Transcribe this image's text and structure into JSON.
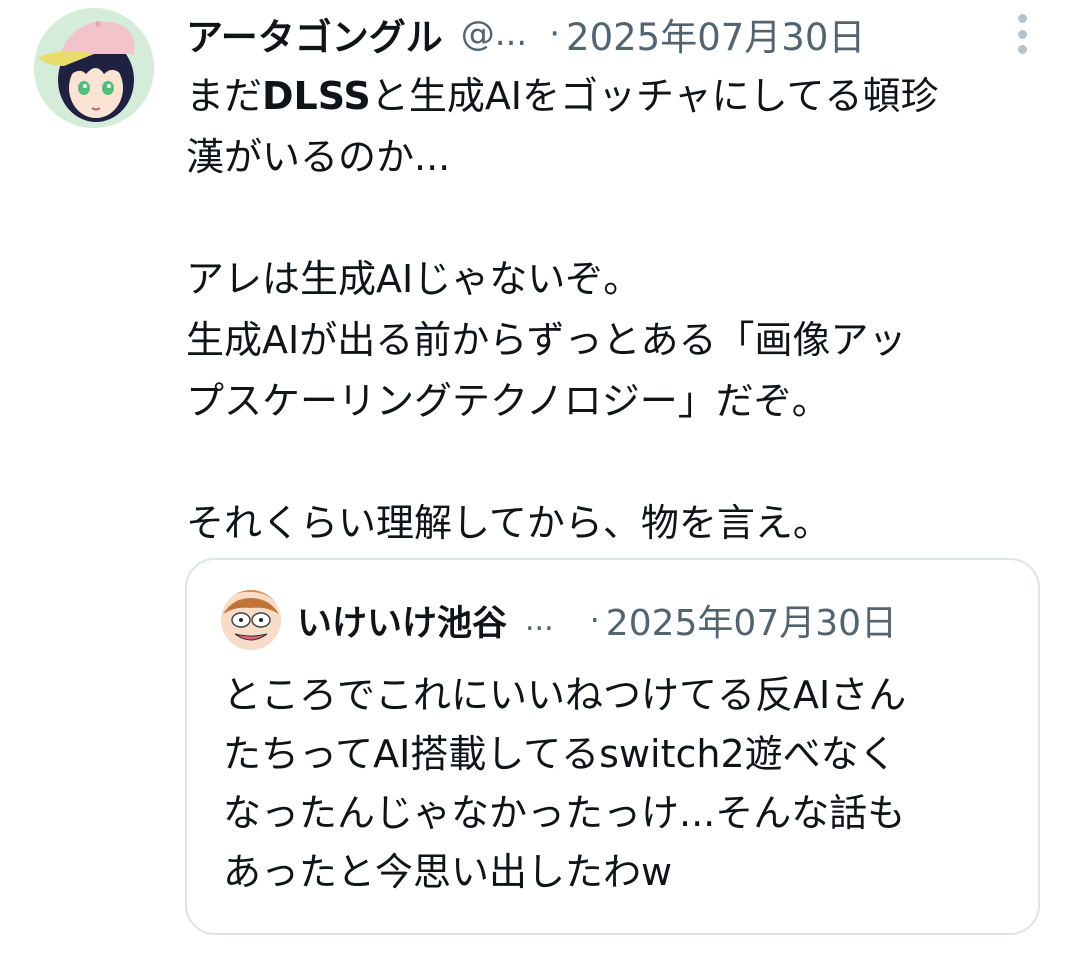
{
  "post": {
    "author_name": "アータゴングル",
    "handle": "@...",
    "separator": "·",
    "date": "2025年07月30日",
    "avatar_icon": "anime-character-avatar-icon",
    "more_icon": "vertical-ellipsis-icon",
    "body": {
      "line1_pre": "まだ",
      "line1_bold": "DLSS",
      "line1_post": "と生成AIをゴッチャにしてる頓珍",
      "line2": "漢がいるのか...",
      "line3": "アレは生成AIじゃないぞ。",
      "line4": "生成AIが出る前からずっとある「画像アッ",
      "line5": "プスケーリングテクノロジー」だぞ。",
      "line6": "それくらい理解してから、物を言え。"
    }
  },
  "quote": {
    "author_name": "いけいけ池谷",
    "handle": "...",
    "separator": "·",
    "date": "2025年07月30日",
    "avatar_icon": "cartoon-face-avatar-icon",
    "body": {
      "line1": "ところでこれにいいねつけてる反AIさん",
      "line2": "たちってAI搭載してるswitch2遊べなく",
      "line3": "なったんじゃなかったっけ...そんな話も",
      "line4": "あったと今思い出したわw"
    }
  },
  "colors": {
    "text_primary": "#0f1419",
    "text_secondary": "#536471",
    "border": "#dfe4e8",
    "background": "#ffffff"
  }
}
